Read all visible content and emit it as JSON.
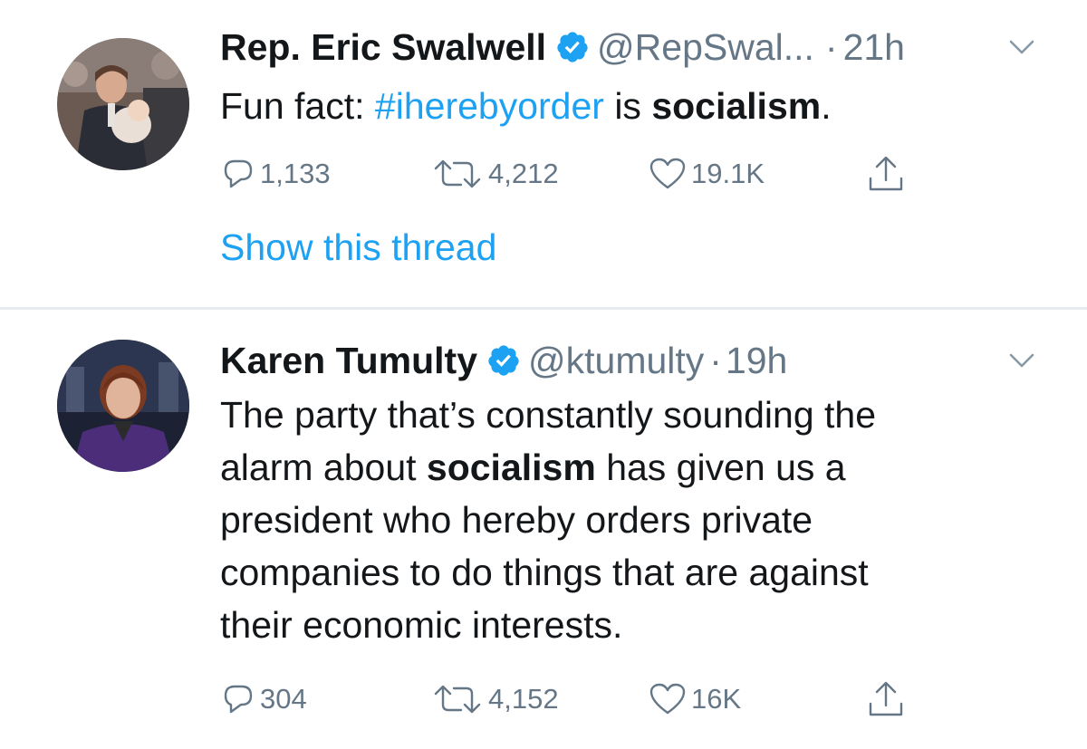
{
  "tweets": [
    {
      "name": "Rep. Eric Swalwell",
      "handle": "@RepSwal...",
      "dot": "·",
      "time": "21h",
      "text_parts": [
        "Fun fact: ",
        "#iherebyorder",
        " is ",
        "socialism",
        "."
      ],
      "stats": {
        "replies": "1,133",
        "retweets": "4,212",
        "likes": "19.1K"
      },
      "show_thread": "Show this thread"
    },
    {
      "name": "Karen Tumulty",
      "handle": "@ktumulty",
      "dot": "·",
      "time": "19h",
      "text_lines": [
        [
          "The party that’s constantly sounding the"
        ],
        [
          "alarm about ",
          "socialism",
          " has given us a"
        ],
        [
          "president who hereby orders private"
        ],
        [
          "companies to do things that are against"
        ],
        [
          "their economic interests."
        ]
      ],
      "stats": {
        "replies": "304",
        "retweets": "4,152",
        "likes": "16K"
      }
    }
  ],
  "icons": {
    "verified": "verified-badge-icon",
    "chevron": "chevron-down-icon",
    "reply": "reply-bubble-icon",
    "retweet": "retweet-icon",
    "like": "heart-icon",
    "share": "share-upload-icon"
  },
  "colors": {
    "accent": "#1da1f2",
    "text": "#14171a",
    "muted": "#657786",
    "divider": "#e6ecf0"
  }
}
